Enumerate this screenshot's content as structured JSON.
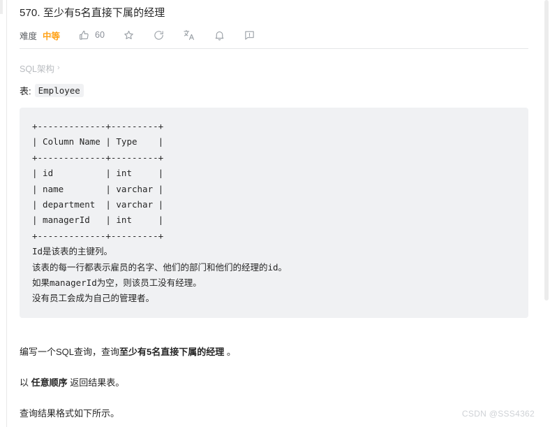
{
  "problem": {
    "title": "570. 至少有5名直接下属的经理",
    "difficulty_label": "难度",
    "difficulty_value": "中等",
    "difficulty_color": "#FFA116",
    "like_count": "60"
  },
  "toolbar": {
    "like_icon": "thumbs-up-icon",
    "favorite_icon": "star-icon",
    "refresh_icon": "refresh-icon",
    "translate_icon": "translate-icon",
    "notify_icon": "bell-icon",
    "report_icon": "report-icon"
  },
  "breadcrumb": {
    "label": "SQL架构",
    "chevron": "›"
  },
  "table_section": {
    "prefix": "表:",
    "table_name": "Employee"
  },
  "code_block": {
    "schema": "+-------------+---------+\n| Column Name | Type    |\n+-------------+---------+\n| id          | int     |\n| name        | varchar |\n| department  | varchar |\n| managerId   | int     |\n+-------------+---------+",
    "notes": "Id是该表的主键列。\n该表的每一行都表示雇员的名字、他们的部门和他们的经理的id。\n如果managerId为空，则该员工没有经理。\n没有员工会成为自己的管理者。"
  },
  "description": {
    "p1_before": "编写一个SQL查询，查询",
    "p1_bold": "至少有5名直接下属的经理",
    "p1_after": " 。",
    "p2_before": "以 ",
    "p2_bold": "任意顺序",
    "p2_after": " 返回结果表。",
    "p3": "查询结果格式如下所示。"
  },
  "watermark": {
    "text": "CSDN @SSS4362"
  }
}
